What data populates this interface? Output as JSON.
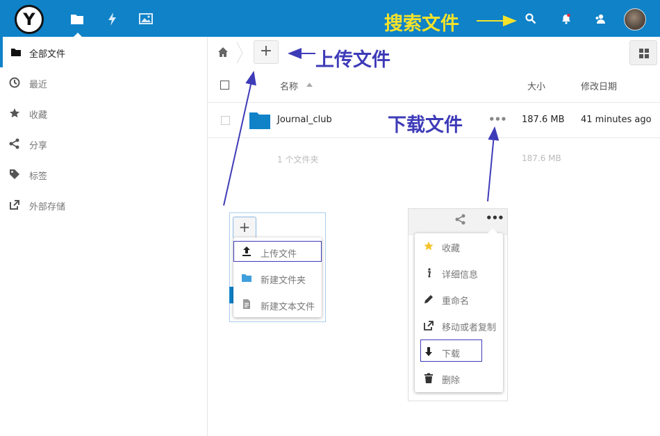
{
  "header": {
    "logo_letter": "Y",
    "nav_icons": [
      "files-icon",
      "activity-icon",
      "gallery-icon"
    ],
    "right_icons": [
      "search-icon",
      "notifications-icon",
      "contacts-icon"
    ],
    "accent_color": "#0f82c8"
  },
  "sidebar": {
    "items": [
      {
        "label": "全部文件",
        "icon": "folder-icon",
        "active": true
      },
      {
        "label": "最近",
        "icon": "clock-icon"
      },
      {
        "label": "收藏",
        "icon": "star-icon"
      },
      {
        "label": "分享",
        "icon": "share-icon"
      },
      {
        "label": "标签",
        "icon": "tag-icon"
      },
      {
        "label": "外部存储",
        "icon": "external-storage-icon"
      }
    ]
  },
  "controls": {
    "new_button": "+"
  },
  "table": {
    "headers": {
      "name": "名称",
      "size": "大小",
      "modified": "修改日期"
    },
    "rows": [
      {
        "name": "Journal_club",
        "size": "187.6 MB",
        "modified": "41 minutes ago",
        "actions": "•••"
      }
    ],
    "summary": {
      "count": "1 个文件夹",
      "size": "187.6 MB"
    }
  },
  "upload_menu": {
    "plus": "+",
    "items": [
      {
        "label": "上传文件",
        "icon": "upload-icon"
      },
      {
        "label": "新建文件夹",
        "icon": "folder-icon"
      },
      {
        "label": "新建文本文件",
        "icon": "text-file-icon"
      }
    ]
  },
  "actions_menu": {
    "dots": "•••",
    "items": [
      {
        "label": "收藏",
        "icon": "star-icon"
      },
      {
        "label": "详细信息",
        "icon": "info-icon"
      },
      {
        "label": "重命名",
        "icon": "pencil-icon"
      },
      {
        "label": "移动或者复制",
        "icon": "external-link-icon"
      },
      {
        "label": "下载",
        "icon": "download-icon"
      },
      {
        "label": "删除",
        "icon": "trash-icon"
      }
    ]
  },
  "annotations": {
    "search": "搜索文件",
    "upload": "上传文件",
    "download": "下载文件",
    "search_color": "#f5e22a",
    "arrow_color": "#3e3bb8"
  }
}
